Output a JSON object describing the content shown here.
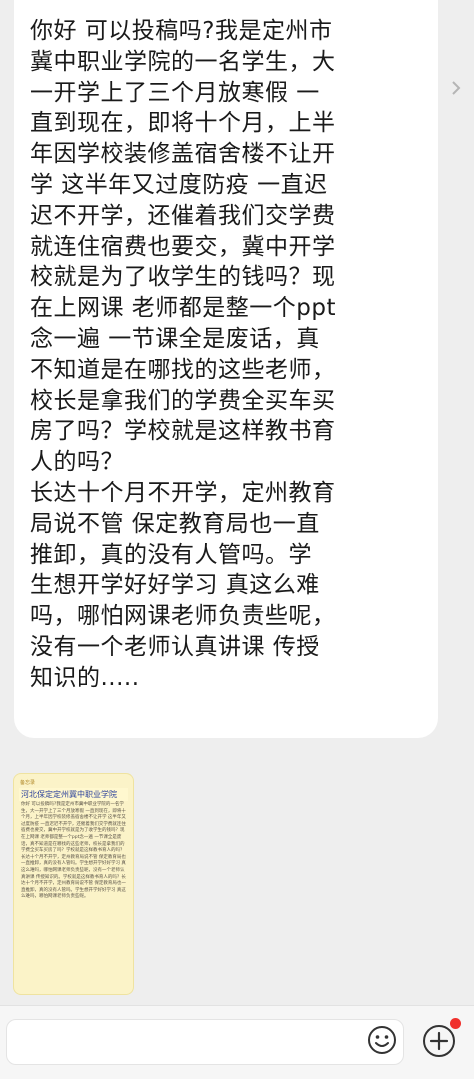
{
  "message": {
    "text": "你好 可以投稿吗?我是定州市\n冀中职业学院的一名学生，大\n一开学上了三个月放寒假 一\n直到现在，即将十个月，上半\n年因学校装修盖宿舍楼不让开\n学 这半年又过度防疫 一直迟\n迟不开学，还催着我们交学费\n就连住宿费也要交，冀中开学\n校就是为了收学生的钱吗？现\n在上网课 老师都是整一个ppt\n念一遍 一节课全是废话，真\n不知道是在哪找的这些老师，\n校长是拿我们的学费全买车买\n房了吗？学校就是这样教书育\n人的吗？\n长达十个月不开学，定州教育\n局说不管 保定教育局也一直\n推卸，真的没有人管吗。学\n生想开学好好学习 真这么难\n吗，哪怕网课老师负责些呢，\n没有一个老师认真讲课 传授\n知识的....."
  },
  "attachment": {
    "tag": "备忘录",
    "title": "河北保定定州冀中职业学院",
    "body": "你好 可以投稿吗?我是定州市冀中职业学院的一名学生，大一开学上了三个月放寒假 一直到现在，即将十个月，上半年因学校装修盖宿舍楼不让开学 这半年又过度防疫 一直迟迟不开学，还催着我们交学费就连住宿费也要交，冀中开学校就是为了收学生的钱吗？现在上网课 老师都是整一个ppt念一遍 一节课全是废话，真不知道是在哪找的这些老师，校长是拿我们的学费全买车买房了吗？学校就是这样教书育人的吗？长达十个月不开学，定州教育局说不管 保定教育局也一直推卸，真的没有人管吗。学生想开学好好学习 真这么难吗，哪怕网课老师负责些呢，没有一个老师认真讲课 传授知识的。学校就是这样教书育人的吗？长达十个月不开学，定州教育局说不管 保定教育局也一直推卸，真的没有人管吗。学生想开学好好学习 真这么难吗，哪怕网课老师负责些呢。"
  },
  "icons": {
    "expand": "chevron-right-icon",
    "emoji": "smiley-icon",
    "more": "plus-circle-icon"
  },
  "colors": {
    "chat_background": "#eeeeee",
    "bubble": "#ffffff",
    "badge": "#f0302c",
    "note_paper": "#fbf3c8"
  }
}
